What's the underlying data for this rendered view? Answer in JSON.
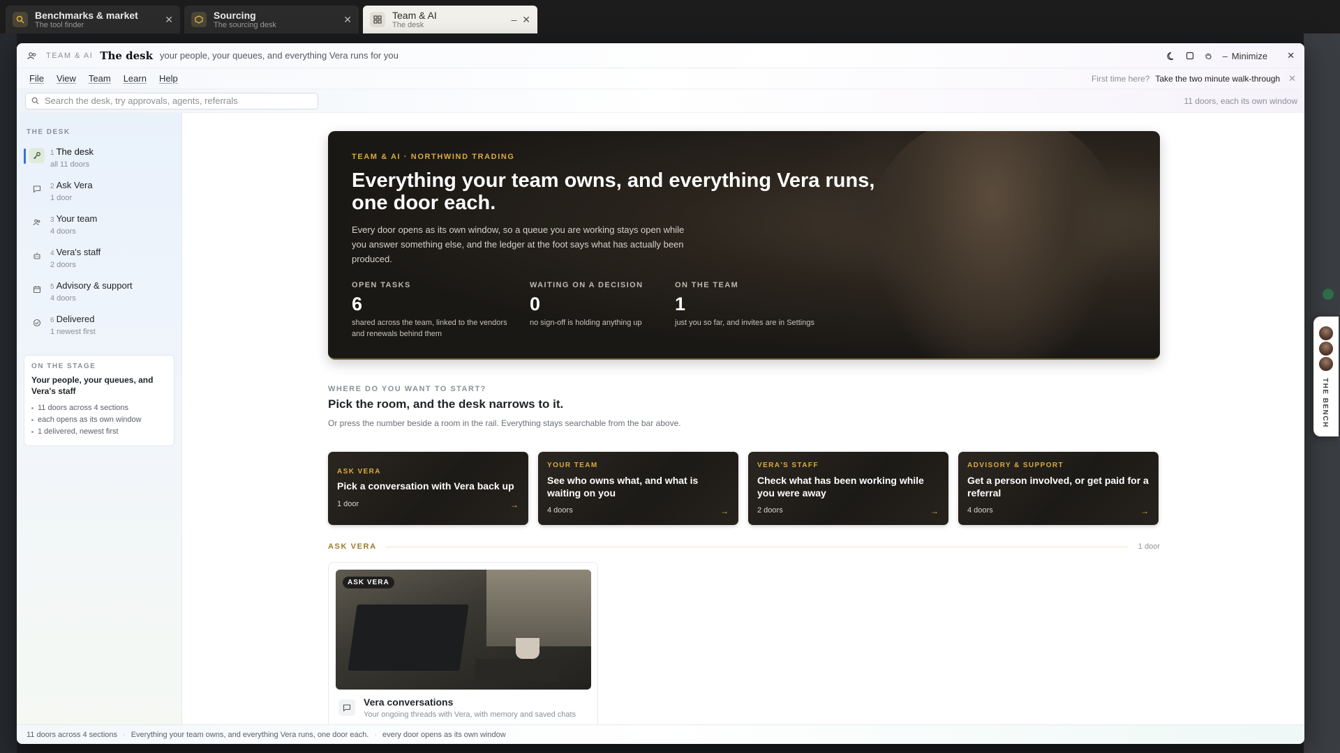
{
  "tabs": [
    {
      "title": "Benchmarks & market",
      "subtitle": "The tool finder"
    },
    {
      "title": "Sourcing",
      "subtitle": "The sourcing desk"
    },
    {
      "title": "Team & AI",
      "subtitle": "The desk"
    }
  ],
  "window": {
    "kicker": "TEAM & AI",
    "title": "The desk",
    "subtitle": "your people, your queues, and everything Vera runs for you",
    "minimize_label": "Minimize"
  },
  "menu": {
    "items": [
      "File",
      "View",
      "Team",
      "Learn",
      "Help"
    ],
    "walkthrough_question": "First time here?",
    "walkthrough_cta": "Take the two minute walk-through"
  },
  "search": {
    "placeholder": "Search the desk, try approvals, agents, referrals",
    "doors_note": "11 doors, each its own window"
  },
  "sidebar": {
    "section_label": "THE DESK",
    "items": [
      {
        "num": "1",
        "label": "The desk",
        "sub": "all 11 doors",
        "icon": "key-icon"
      },
      {
        "num": "2",
        "label": "Ask Vera",
        "sub": "1 door",
        "icon": "chat-icon"
      },
      {
        "num": "3",
        "label": "Your team",
        "sub": "4 doors",
        "icon": "people-icon"
      },
      {
        "num": "4",
        "label": "Vera's staff",
        "sub": "2 doors",
        "icon": "robot-icon"
      },
      {
        "num": "5",
        "label": "Advisory & support",
        "sub": "4 doors",
        "icon": "calendar-icon"
      },
      {
        "num": "6",
        "label": "Delivered",
        "sub": "1 newest first",
        "icon": "check-circle-icon"
      }
    ],
    "stage": {
      "label": "ON THE STAGE",
      "heading": "Your people, your queues, and Vera's staff",
      "items": [
        "11 doors across 4 sections",
        "each opens as its own window",
        "1 delivered, newest first"
      ]
    }
  },
  "hero": {
    "kicker": "TEAM & AI · NORTHWIND TRADING",
    "heading": "Everything your team owns, and everything Vera runs, one door each.",
    "lede": "Every door opens as its own window, so a queue you are working stays open while you answer something else, and the ledger at the foot says what has actually been produced.",
    "stats": [
      {
        "label": "OPEN TASKS",
        "value": "6",
        "desc": "shared across the team, linked to the vendors and renewals behind them"
      },
      {
        "label": "WAITING ON A DECISION",
        "value": "0",
        "desc": "no sign-off is holding anything up"
      },
      {
        "label": "ON THE TEAM",
        "value": "1",
        "desc": "just you so far, and invites are in Settings"
      }
    ]
  },
  "start": {
    "kicker": "WHERE DO YOU WANT TO START?",
    "heading": "Pick the room, and the desk narrows to it.",
    "body": "Or press the number beside a room in the rail. Everything stays searchable from the bar above."
  },
  "rooms": [
    {
      "kicker": "ASK VERA",
      "title": "Pick a conversation with Vera back up",
      "doors": "1 door"
    },
    {
      "kicker": "YOUR TEAM",
      "title": "See who owns what, and what is waiting on you",
      "doors": "4 doors"
    },
    {
      "kicker": "VERA'S STAFF",
      "title": "Check what has been working while you were away",
      "doors": "2 doors"
    },
    {
      "kicker": "ADVISORY & SUPPORT",
      "title": "Get a person involved, or get paid for a referral",
      "doors": "4 doors"
    }
  ],
  "section": {
    "label": "ASK VERA",
    "count": "1 door"
  },
  "door_card": {
    "badge": "ASK VERA",
    "title": "Vera conversations",
    "subtitle": "Your ongoing threads with Vera, with memory and saved chats"
  },
  "statusbar": {
    "items": [
      "11 doors across 4 sections",
      "Everything your team owns, and everything Vera runs, one door each.",
      "every door opens as its own window"
    ]
  },
  "bench": {
    "label": "THE BENCH"
  },
  "colors": {
    "accent_gold": "#d9ab3f",
    "active_bar": "#3b6fd8",
    "hero_bg": "#1a1815"
  }
}
